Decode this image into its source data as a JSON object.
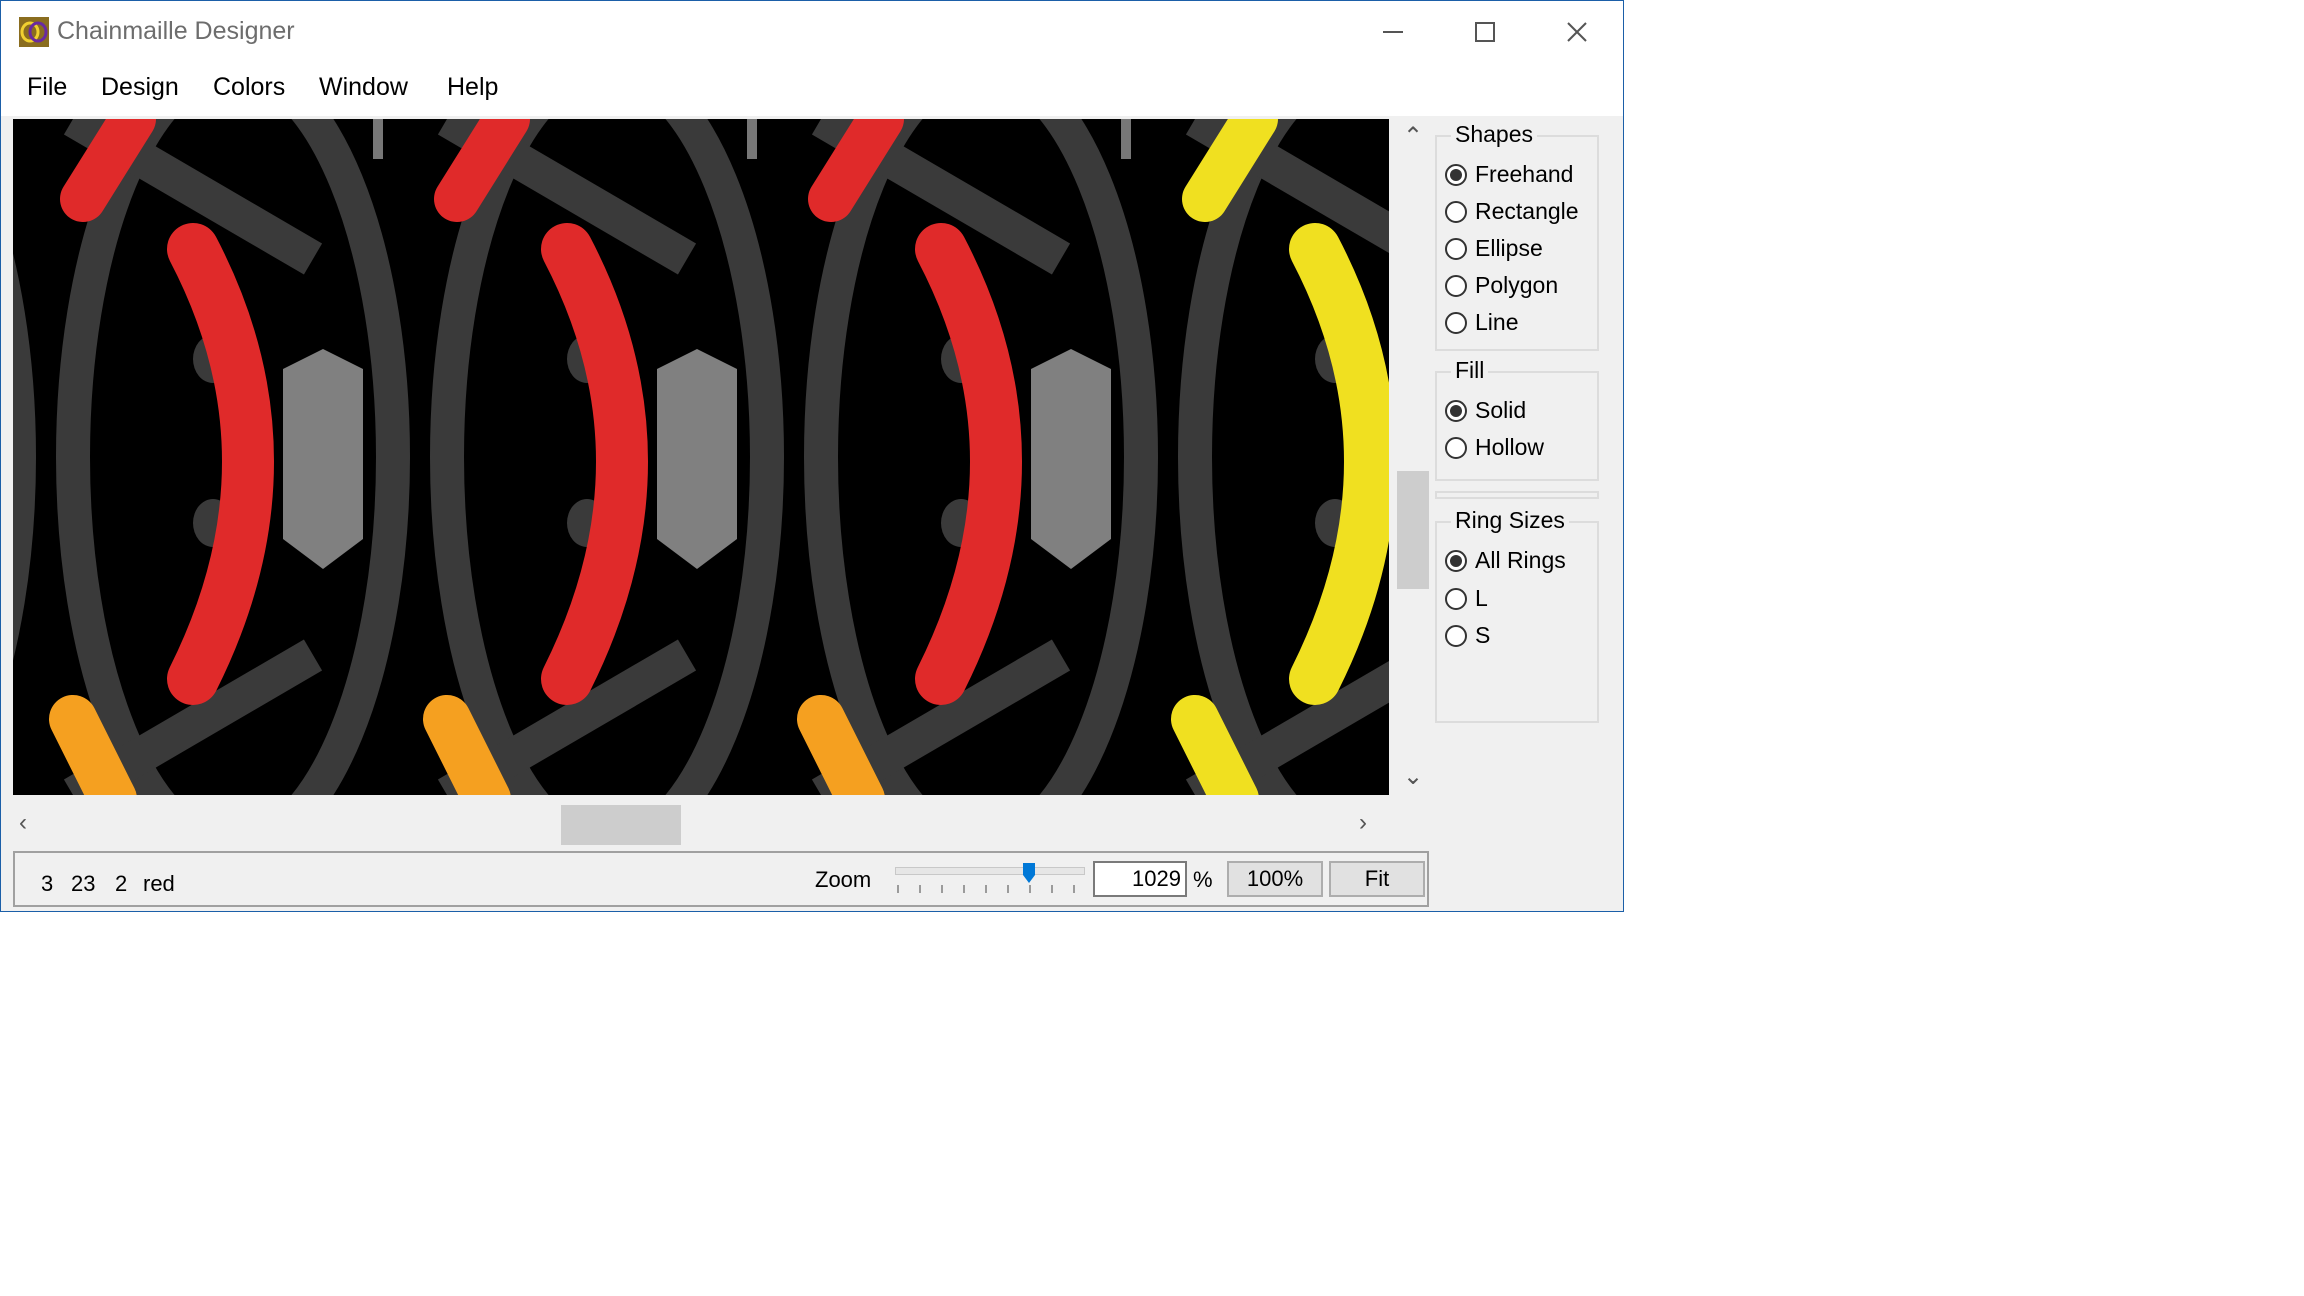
{
  "window": {
    "title": "Chainmaille Designer",
    "controls": {
      "minimize": "minimize-icon",
      "maximize": "maximize-icon",
      "close": "close-icon"
    }
  },
  "menu": [
    "File",
    "Design",
    "Colors",
    "Window",
    "Help"
  ],
  "status": {
    "col1": "3",
    "col2": "23",
    "col3": "2",
    "color": "red"
  },
  "zoom": {
    "label": "Zoom",
    "value": "1029",
    "unit": "%",
    "btn_100": "100%",
    "btn_fit": "Fit",
    "slider_level": 0.75
  },
  "panel": {
    "shapes": {
      "title": "Shapes",
      "options": [
        "Freehand",
        "Rectangle",
        "Ellipse",
        "Polygon",
        "Line"
      ],
      "selected": "Freehand"
    },
    "fill": {
      "title": "Fill",
      "options": [
        "Solid",
        "Hollow"
      ],
      "selected": "Solid"
    },
    "ring_sizes": {
      "title": "Ring Sizes",
      "options": [
        "All Rings",
        "L",
        "S"
      ],
      "selected": "All Rings"
    }
  },
  "colors": {
    "ring_dark": "#3a3a3a",
    "ring_grey": "#808080",
    "red": "#e02a2a",
    "yellow": "#f0e020",
    "orange": "#f5a020",
    "background": "#000000"
  }
}
